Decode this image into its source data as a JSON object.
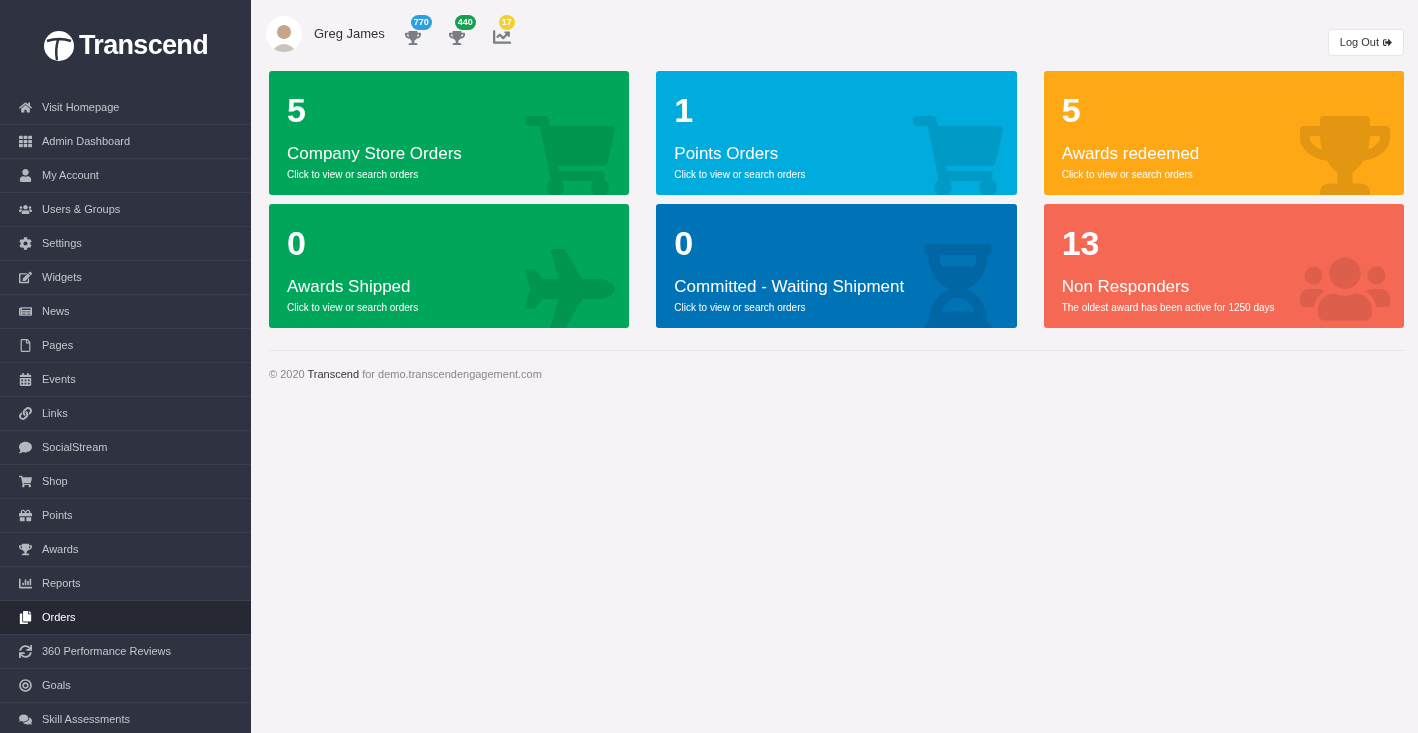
{
  "logo": {
    "text": "Transcend"
  },
  "sidebar": {
    "items": [
      {
        "kind": "home",
        "label": "Visit Homepage",
        "selected": false
      },
      {
        "kind": "dashboard",
        "label": "Admin Dashboard",
        "selected": false
      },
      {
        "kind": "user",
        "label": "My Account",
        "selected": false
      },
      {
        "kind": "users",
        "label": "Users & Groups",
        "selected": false
      },
      {
        "kind": "settings",
        "label": "Settings",
        "selected": false
      },
      {
        "kind": "edit",
        "label": "Widgets",
        "selected": false
      },
      {
        "kind": "news",
        "label": "News",
        "selected": false
      },
      {
        "kind": "page",
        "label": "Pages",
        "selected": false
      },
      {
        "kind": "calendar",
        "label": "Events",
        "selected": false
      },
      {
        "kind": "link",
        "label": "Links",
        "selected": false
      },
      {
        "kind": "comment",
        "label": "SocialStream",
        "selected": false
      },
      {
        "kind": "cart",
        "label": "Shop",
        "selected": false
      },
      {
        "kind": "gift",
        "label": "Points",
        "selected": false
      },
      {
        "kind": "trophy",
        "label": "Awards",
        "selected": false
      },
      {
        "kind": "chart",
        "label": "Reports",
        "selected": false
      },
      {
        "kind": "copy",
        "label": "Orders",
        "selected": true
      },
      {
        "kind": "sync",
        "label": "360 Performance Reviews",
        "selected": false
      },
      {
        "kind": "target",
        "label": "Goals",
        "selected": false
      },
      {
        "kind": "comments",
        "label": "Skill Assessments",
        "selected": false
      }
    ]
  },
  "header": {
    "user_name": "Greg James",
    "badges": [
      {
        "kind": "trophy",
        "count": "770",
        "color": "#2d9ee0"
      },
      {
        "kind": "trophy",
        "count": "440",
        "color": "#14a04c"
      },
      {
        "kind": "chart",
        "count": "17",
        "color": "#f3d02b"
      }
    ],
    "logout": "Log Out"
  },
  "cards": [
    {
      "kind": "cart",
      "value": "5",
      "title": "Company Store Orders",
      "subtitle": "Click to view or search orders",
      "color": "#00a65a"
    },
    {
      "kind": "cart",
      "value": "1",
      "title": "Points Orders",
      "subtitle": "Click to view or search orders",
      "color": "#00acde"
    },
    {
      "kind": "trophy",
      "value": "5",
      "title": "Awards redeemed",
      "subtitle": "Click to view or search orders",
      "color": "#fda814"
    },
    {
      "kind": "plane",
      "value": "0",
      "title": "Awards Shipped",
      "subtitle": "Click to view or search orders",
      "color": "#00a65a"
    },
    {
      "kind": "hourglass",
      "value": "0",
      "title": "Committed - Waiting Shipment",
      "subtitle": "Click to view or search orders",
      "color": "#0073b7"
    },
    {
      "kind": "users",
      "value": "13",
      "title": "Non Responders",
      "subtitle": "The oldest award has been active for 1250 days",
      "color": "#f56954"
    }
  ],
  "footer": {
    "prefix": "© 2020",
    "brand": "Transcend",
    "suffix": "for demo.transcendengagement.com"
  }
}
